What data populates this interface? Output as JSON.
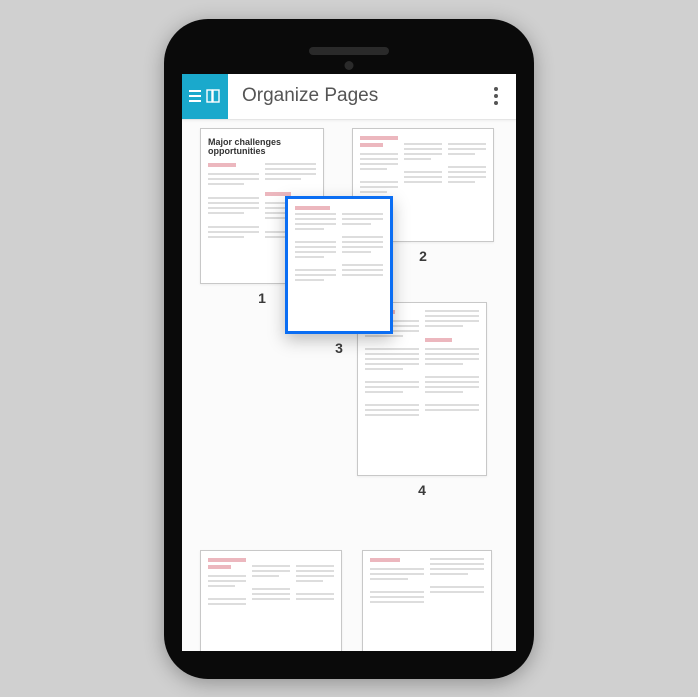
{
  "appbar": {
    "title": "Organize Pages"
  },
  "pages": {
    "p1": {
      "label": "1",
      "heading": "Major challenges opportunities"
    },
    "p2": {
      "label": "2"
    },
    "p3": {
      "label": "3"
    },
    "p4": {
      "label": "4"
    }
  },
  "colors": {
    "accent": "#1aa9cc",
    "selection": "#0b6ef3"
  }
}
